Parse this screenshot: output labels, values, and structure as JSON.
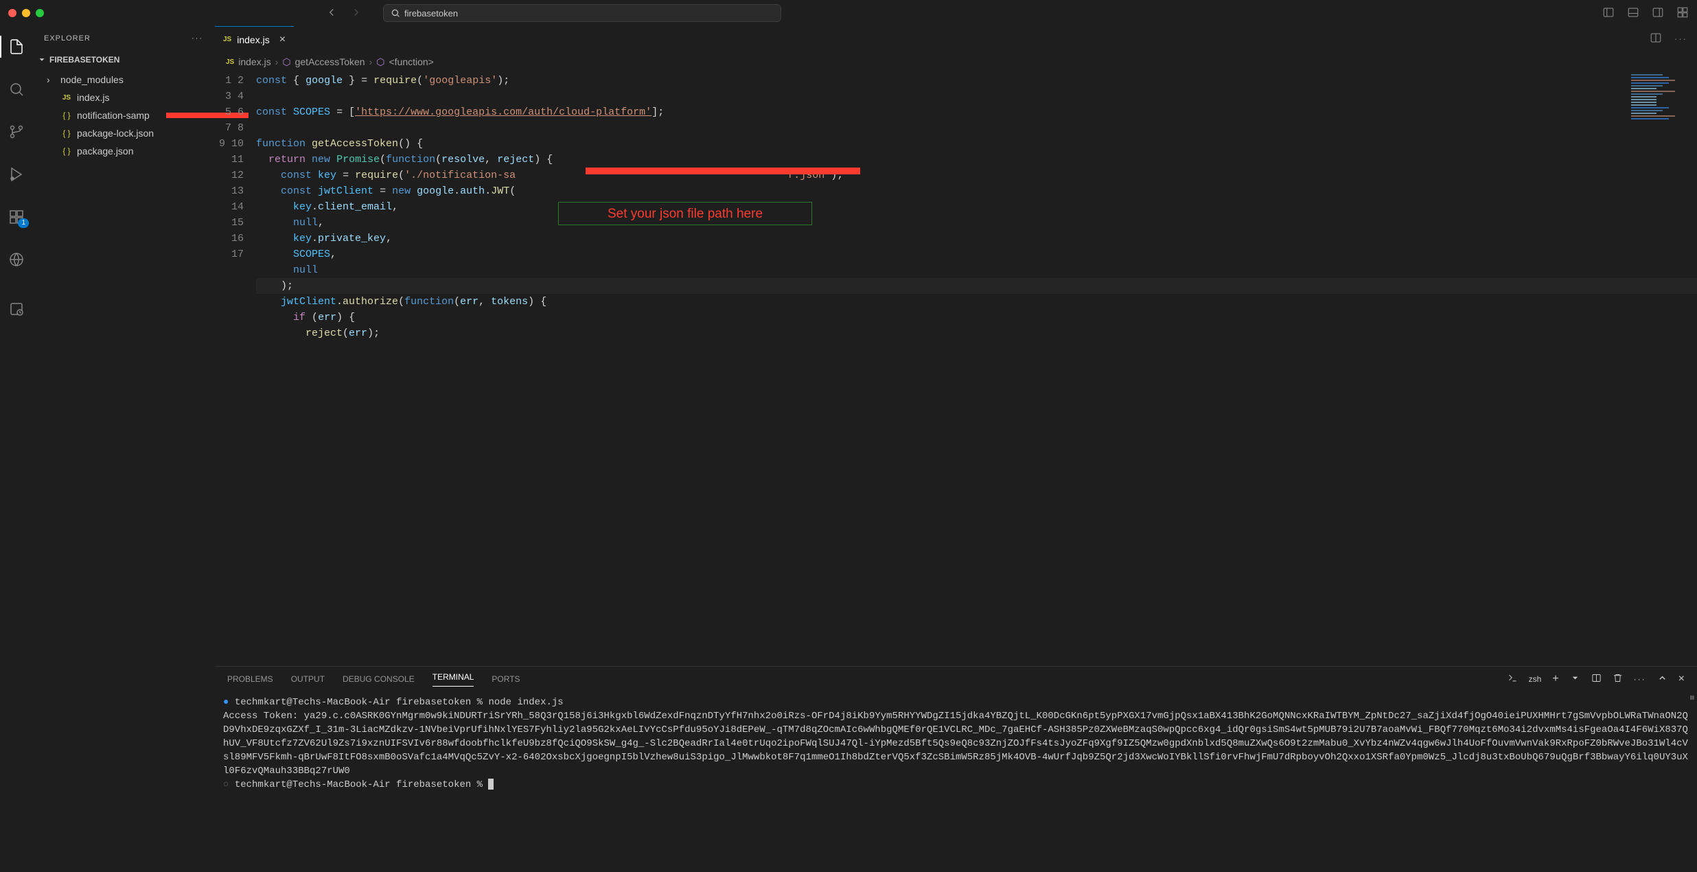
{
  "titlebar": {
    "search_text": "firebasetoken"
  },
  "sidebar": {
    "title": "EXPLORER",
    "project_name": "FIREBASETOKEN",
    "files": [
      {
        "name": "node_modules",
        "icon": "folder",
        "chevron": true
      },
      {
        "name": "index.js",
        "icon": "js"
      },
      {
        "name": "notification-samp",
        "icon": "json",
        "redacted": true
      },
      {
        "name": "package-lock.json",
        "icon": "json"
      },
      {
        "name": "package.json",
        "icon": "json"
      }
    ]
  },
  "activity": {
    "ext_badge": "1"
  },
  "tab": {
    "label": "index.js"
  },
  "breadcrumb": {
    "file": "index.js",
    "symbol1": "getAccessToken",
    "symbol2": "<function>"
  },
  "editor": {
    "line_numbers": [
      "1",
      "2",
      "3",
      "4",
      "5",
      "6",
      "7",
      "8",
      "9",
      "10",
      "11",
      "12",
      "13",
      "14",
      "15",
      "16",
      "17"
    ]
  },
  "annotation": {
    "text": "Set your json file path here"
  },
  "panel": {
    "tabs": [
      "PROBLEMS",
      "OUTPUT",
      "DEBUG CONSOLE",
      "TERMINAL",
      "PORTS"
    ],
    "active_tab": "TERMINAL",
    "shell": "zsh",
    "terminal_lines": [
      "techmkart@Techs-MacBook-Air firebasetoken % node index.js",
      "Access Token: ya29.c.c0ASRK0GYnMgrm0w9kiNDURTriSrYRh_58Q3rQ158j6i3Hkgxbl6WdZexdFnqznDTyYfH7nhx2o0iRzs-OFrD4j8iKb9Yym5RHYYWDgZI15jdka4YBZQjtL_K00DcGKn6pt5ypPXGX17vmGjpQsx1aBX413BhK2GoMQNNcxKRaIWTBYM_ZpNtDc27_saZjiXd4fjOgO40ieiPUXHMHrt7gSmVvpbOLWRaTWnaON2QD9VhxDE9zqxGZXf_I_31m-3LiacMZdkzv-1NVbeiVprUfihNxlYES7Fyhliy2la95G2kxAeLIvYcCsPfdu95oYJi8dEPeW_-qTM7d8qZOcmAIc6wWhbgQMEf0rQE1VCLRC_MDc_7gaEHCf-ASH385Pz0ZXWeBMzaqS0wpQpcc6xg4_idQr0gsiSmS4wt5pMUB79i2U7B7aoaMvWi_FBQf770Mqzt6Mo34i2dvxmMs4isFgeaOa4I4F6WiX837QhUV_VF8Utcfz7ZV62Ul9Zs7i9xznUIFSVIv6r88wfdoobfhclkfeU9bz8fQciQO9SkSW_g4g_-Slc2BQeadRrIal4e0trUqo2ipoFWqlSUJ47Ql-iYpMezd5Bft5Qs9eQ8c93ZnjZOJfFs4tsJyoZFq9Xgf9IZ5QMzw0gpdXnblxd5Q8muZXwQs6O9t2zmMabu0_XvYbz4nWZv4qgw6wJlh4UoFfOuvmVwnVak9RxRpoFZ0bRWveJBo31Wl4cVsl89MFV5Fkmh-qBrUwF8ItFO8sxmB0oSVafc1a4MVqQc5ZvY-x2-6402OxsbcXjgoegnpI5blVzhew8uiS3pigo_JlMwwbkot8F7q1mmeO1Ih8bdZterVQ5xf3ZcSBimW5Rz85jMk4OVB-4wUrfJqb9Z5Qr2jd3XwcWoIYBkllSfi0rvFhwjFmU7dRpboyvOh2Qxxo1XSRfa0Ypm0Wz5_Jlcdj8u3txBoUbQ679uQgBrf3BbwayY6ilq0UY3uXl0F6zvQMauh33BBq27rUW0",
      "techmkart@Techs-MacBook-Air firebasetoken % "
    ]
  }
}
